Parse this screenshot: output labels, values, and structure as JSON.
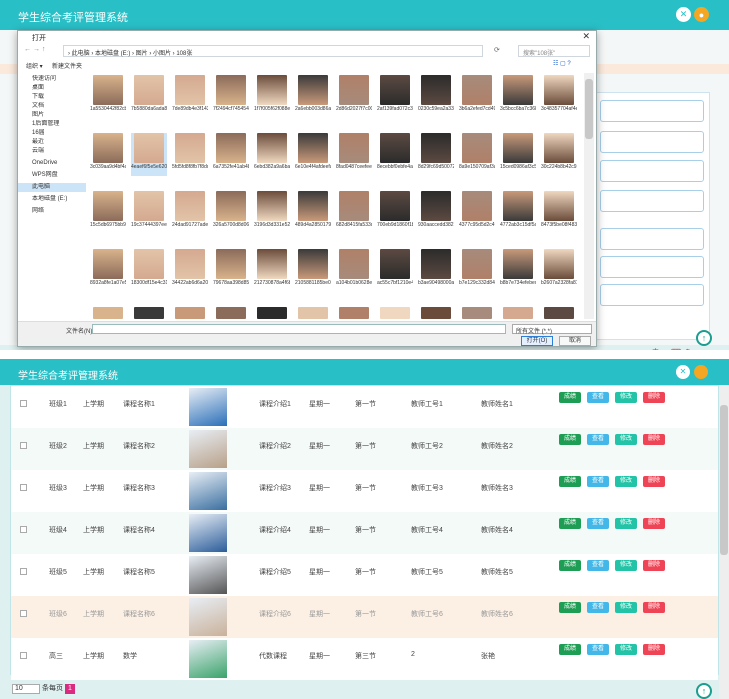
{
  "app": {
    "title": "学生综合考评管理系统"
  },
  "dialog": {
    "title": "打开",
    "close": "✕",
    "address": "› 此电脑 › 本地磁盘 (E:) › 图片 › 小图片 › 108张",
    "search_placeholder": "搜索\"108张\"",
    "organize": "组织 ▾",
    "new_folder": "新建文件夹",
    "nav_items": [
      "快速访问",
      "桌面",
      "下载",
      "文档",
      "图片",
      "1后面管理",
      "16届",
      "最近",
      "云端",
      "OneDrive",
      "WPS网盘",
      "此电脑",
      "本地磁盘 (E:)",
      "网络"
    ],
    "files": [
      "1a5530442f82c b677c7c1f2b78 b3a49c.jpg",
      "7b5880da6ada8 9074152604a24 2fb1df.jpg",
      "7de89db4e3f14 330b48c490194 f554e.jpg",
      "7f2494cf745454 035348e54b073 cd09.jpg",
      "1f7f005f62f088 e67aa8825c3bf 71 0ffdb.jpg",
      "2a6ebb003d86 a2ece0f7405 0e42d80e5.jpg",
      "2d86d2027f7 c0 0e5ff4c520e0 f4 6 00032c.jpg",
      "2af139fad072c3 6c2fa35537 3d6 964d9b.png",
      "0230c59ea2a3 3b0138 4a6e54 50ea69e.jpg",
      "3b6a2efed7cd4 918fb85277 0e7 abec1c.jpg",
      "3c5bcc6ba7c 3 6853025b2407 1 2fa2ba.jpg",
      "3c4835770 4a f4 e7ad48d3 0756 36c9 3.jpg",
      "3c039aa9d4bf4 a476a45 81a7c 6 0190.jpg",
      "4eaef6f5e 5e62 0cc7125200 d 0 6 65e038.jpg",
      "5fd5fd8f8 fb 7f8 dc09 b5d09 4c0 2 0 2 5 341.jpg",
      "6a7352 fe41ab4 8317 12d47 d 9 d9 90 09 6ea.jpg",
      "6ebd382a 9a6b a3 36 4eaef3a 5320 6 56916 4.jpg",
      "6e10e4 f4afdee f a b6eb5007fe573 b 49a1b.jpg",
      "8fad04 87ceefe e6 08f0 0 99f5 02 c 2 ef e49.jpg",
      "8ecebbf 0ebfe 4a a 3df0 da 3642 5 0 5 e 1 3 bb.jpg",
      "8d2 9fc 6 9d 5 0 0 7 2 b01 e 9 1 2b 6 c 6d 17bd 6 0 a d.jpg",
      "8a9e1 5 0 7 0 9 a f 3 a 94a 8 1 a d b 5 6 b 2 5 8 6 a 6 f.png",
      "1 5 c e d 0 9 8 6 a f 3 c 5 7 a b b 4 7 3 d d 3 0 7 3 0 1 9 8 8 0 0.png",
      "3 0 c 2 2 4 b 8 b 4 2 c 9 2 b f 5 f 0 3 b b 3 4 1 4 2 0 4 b 1 8.jpg",
      "15c5db69 7 5 b b 9 1 1 6 d e 8 f 7 7 b 2 e 1 e 3 4 1 0 8 9 8.jpg",
      "19c3744 4 3 9 7 e e 1 5 b f c b 9 c 5 0 2 5 2 e 5 a a 5 6 9.jpg",
      "2 4 d a d 9 1 7 2 7 a d e 3 6 2 8 9 d 8 d 2 f f a 1 3 0 0 9 9 1 6 c e b 4 a.png",
      "3 2 6 a 5 7 0 0 d 8 d 0 6 9 7 c c 2 4 6 d a 6 a 5 6 8 8 3 2 d 0 a 1 4.png",
      "3 1 9 6 d 3 d 3 3 1 e 5 2 a 7 c d e a 2 e 4 6 5 4 2 5 7 0 f 4 f 7 7.jpg",
      "4 8 9 d 4 a 2 8 5 0 1 7 9 5 1 8 e 1 8 0 7 6 2 e f 0 d 3 c 9 7.jpg",
      "6 8 2 d 8 4 1 5 f a 5 3 3 d 5 b 5 0 a e b 5 2 1 d c 9 0 2 9 9 c 5 d.jpg",
      "7 0 0 e b 9 d 1 8 6 0 f 1 b 9 1 c 2 4 3 0 b 9 7 4 4 3 0 9 f 3 5.png",
      "9 3 0 a a c c e d d 3 8 2 7 b a 7 5 1 e 5 1 1 4 c 0 3 5 3 3 e a 7.png",
      "4 3 7 7 c 9 5 d 5 d 2 c 4 9 3 4 6 4 b 2 3 f 4 4 d 3 8 4 2 d 0 e.png",
      "4 7 7 2 a b 3 c 1 5 d f 5 a 1 0 5 d 0 a e 4 c 8 0 7 2 0 7 5 0 2 d 4.png",
      "8 4 7 3 f 5 b e 0 8 f 4 8 3 7 0 d 4 8 0 7 b 3 0 8 a 0 5 b 4 e.jpg",
      "8 9 3 2 a 8 f e 1 a 0 7 e 5 6 b 9 5 4 0 2 0 4 8 8 2 3 1 e 3.jpg",
      "1 8 3 0 0 d f 1 5 e 4 c 3 1 4 a d 8 4 e 4 c 4 5 a 5 e 8 6 d d 8.jpg",
      "3 4 4 2 2 a b 6 d 6 a 2 0 0 c c 0 d 6 2 c 8 0 0 8 6 7 a 8 0 4 .jpg",
      "7 9 6 7 8 a a 3 9 8 d 8 5 0 2 f 0 4 3 6 1 2 2 0 0 b 4 8 5 e f.jpg",
      "2 1 2 7 3 0 8 7 8 a 4 f 6 b f 0 d e 2 0 f 4 d 3 d 4 e 9 e c a b .jpg",
      "2 1 0 5 8 8 1 1 8 5 b e 0 b 4 2 2 d 4 e 5 3 9 2 9 8 9 b b f 0 8 9 5.png",
      "a 1 0 4 b 0 1 b 0 6 2 8 e 5 5 1 e c 3 3 9 e 5 5 b 6 8 9 8 2 1 4.png",
      "a c 5 5 c 7 b f 1 2 1 0 e 4 f 0 0 b d a 4 8 0 0 5 0 5 c d d 0 1 4 .png",
      "b 3 a e 9 0 4 9 8 0 0 0 a 6 1 1 3 b 7 4 5 6 b 6 7 4 5 6 d 3 d e 6 6.png",
      "b 7 e 1 2 9 c 3 3 2 d 8 4 f f 9 f d e 4 9 5 e d 0 9 4 0 5 5 0 3 3.png",
      "b 8 b 7 e 7 3 4 e f e b e c a 8 9 5 7 c 3 7 0 c 0 9 4 7 c e e 6 a.png",
      "b 2 6 0 7 a 2 3 2 8 f a 8 1 5 a e d e 2 4 8 4 0 5 2 f f 0 0 1 4 .png"
    ],
    "filename_label": "文件名(N):",
    "filetype": "所有文件 (*.*)",
    "open": "打开(O)",
    "cancel": "取消"
  },
  "table": {
    "rows": [
      {
        "cls": "班级1",
        "term": "上学期",
        "name": "课程名称1",
        "desc": "课程介绍1",
        "week": "星期一",
        "sec": "第一节",
        "tid": "教师工号1",
        "tname": "教师姓名1"
      },
      {
        "cls": "班级2",
        "term": "上学期",
        "name": "课程名称2",
        "desc": "课程介绍2",
        "week": "星期一",
        "sec": "第一节",
        "tid": "教师工号2",
        "tname": "教师姓名2"
      },
      {
        "cls": "班级3",
        "term": "上学期",
        "name": "课程名称3",
        "desc": "课程介绍3",
        "week": "星期一",
        "sec": "第一节",
        "tid": "教师工号3",
        "tname": "教师姓名3"
      },
      {
        "cls": "班级4",
        "term": "上学期",
        "name": "课程名称4",
        "desc": "课程介绍4",
        "week": "星期一",
        "sec": "第一节",
        "tid": "教师工号4",
        "tname": "教师姓名4"
      },
      {
        "cls": "班级5",
        "term": "上学期",
        "name": "课程名称5",
        "desc": "课程介绍5",
        "week": "星期一",
        "sec": "第一节",
        "tid": "教师工号5",
        "tname": "教师姓名5"
      },
      {
        "cls": "班级6",
        "term": "上学期",
        "name": "课程名称6",
        "desc": "课程介绍6",
        "week": "星期一",
        "sec": "第一节",
        "tid": "教师工号6",
        "tname": "教师姓名6"
      },
      {
        "cls": "高三",
        "term": "上学期",
        "name": "数学",
        "desc": "代数课程",
        "week": "星期一",
        "sec": "第三节",
        "tid": "2",
        "tname": "张艳"
      }
    ],
    "actions": [
      "成绩",
      "查看",
      "修改",
      "删除"
    ]
  },
  "pager": {
    "size": "10",
    "total_label": "条每页",
    "page": "1"
  },
  "colors": {
    "header": "#29bfc6",
    "score": "#1e9e55",
    "view": "#43b8e8",
    "edit": "#22c3a6",
    "del": "#ee4455"
  }
}
